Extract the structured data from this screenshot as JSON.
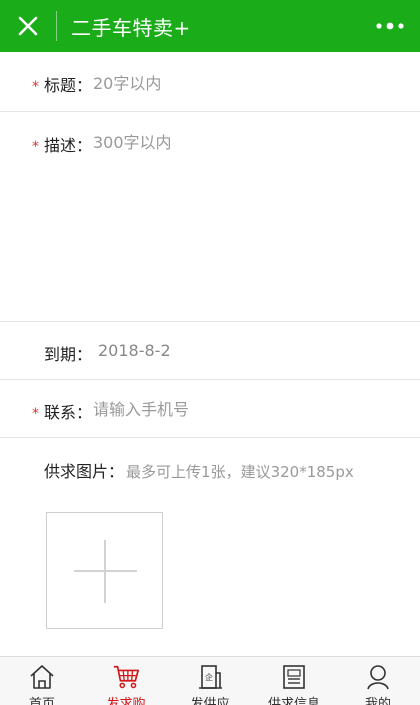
{
  "header": {
    "title": "二手车特卖+",
    "accent": "#1aad19"
  },
  "form": {
    "title": {
      "required": "*",
      "label": "标题",
      "colon": "：",
      "placeholder": "20字以内",
      "value": ""
    },
    "description": {
      "required": "*",
      "label": "描述",
      "colon": "：",
      "placeholder": "300字以内",
      "value": ""
    },
    "expire": {
      "label": "到期",
      "colon": "：",
      "value": "2018-8-2"
    },
    "contact": {
      "required": "*",
      "label": "联系",
      "colon": "：",
      "placeholder": "请输入手机号",
      "value": ""
    },
    "pictures": {
      "label": "供求图片",
      "colon": "：",
      "hint": "最多可上传1张，建议320*185px"
    }
  },
  "tabbar": {
    "active_color": "#d2171b",
    "items": [
      {
        "label": "首页",
        "icon": "home-icon",
        "active": false
      },
      {
        "label": "发求购",
        "icon": "cart-icon",
        "active": true
      },
      {
        "label": "发供应",
        "icon": "building-icon",
        "active": false
      },
      {
        "label": "供求信息",
        "icon": "news-icon",
        "active": false
      },
      {
        "label": "我的",
        "icon": "user-icon",
        "active": false
      }
    ]
  }
}
